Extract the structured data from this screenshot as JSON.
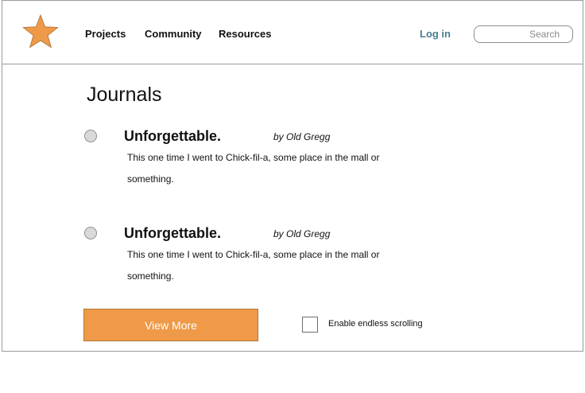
{
  "header": {
    "logo_icon": "star-icon",
    "logo_color": "#ef9a48",
    "nav": [
      {
        "label": "Projects"
      },
      {
        "label": "Community"
      },
      {
        "label": "Resources"
      }
    ],
    "login_label": "Log in",
    "search": {
      "placeholder": "Search",
      "value": ""
    }
  },
  "main": {
    "title": "Journals",
    "entries": [
      {
        "title": "Unforgettable.",
        "author": "by Old Gregg",
        "body": "This one time I went to Chick-fil-a, some place in the mall or something."
      },
      {
        "title": "Unforgettable.",
        "author": "by Old Gregg",
        "body": "This one time I went to Chick-fil-a, some place in the mall or something."
      }
    ],
    "view_more_label": "View More",
    "endless_scroll": {
      "label": "Enable endless scrolling",
      "checked": false
    }
  },
  "colors": {
    "accent": "#ef9a48",
    "link": "#4b7d93"
  }
}
